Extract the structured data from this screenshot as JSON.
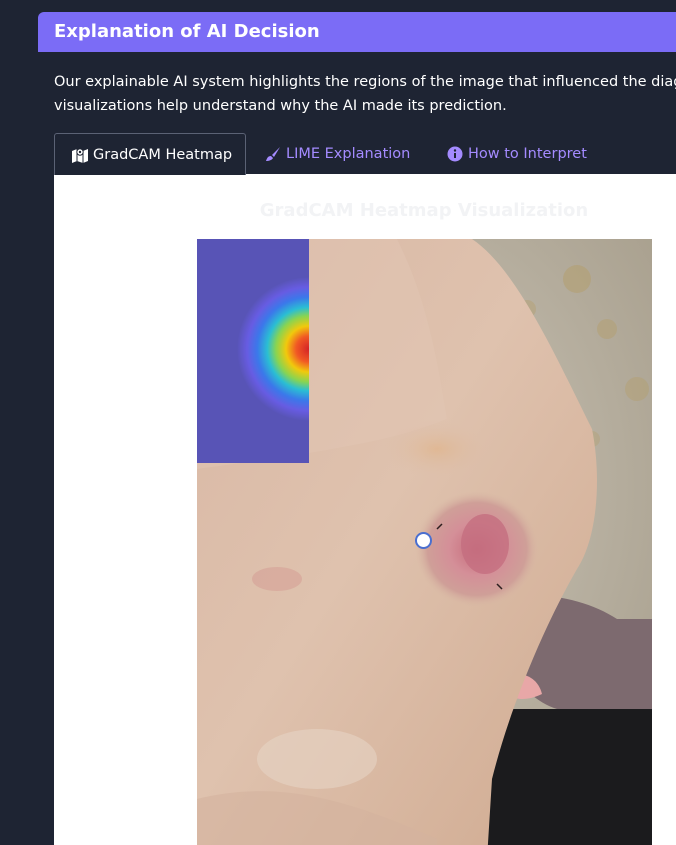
{
  "header": {
    "title": "Explanation of AI Decision"
  },
  "description": {
    "line1": "Our explainable AI system highlights the regions of the image that influenced the diagn",
    "line2": "visualizations help understand why the AI made its prediction."
  },
  "tabs": [
    {
      "label": "GradCAM Heatmap",
      "icon": "map-icon",
      "active": true
    },
    {
      "label": "LIME Explanation",
      "icon": "brush-icon",
      "active": false
    },
    {
      "label": "How to Interpret",
      "icon": "info-icon",
      "active": false
    }
  ],
  "panel": {
    "title": "GradCAM Heatmap Visualization"
  },
  "colors": {
    "header_bg": "#7b6cf6",
    "page_bg": "#1e2433",
    "tab_link": "#a48bff",
    "panel_bg": "#ffffff"
  }
}
